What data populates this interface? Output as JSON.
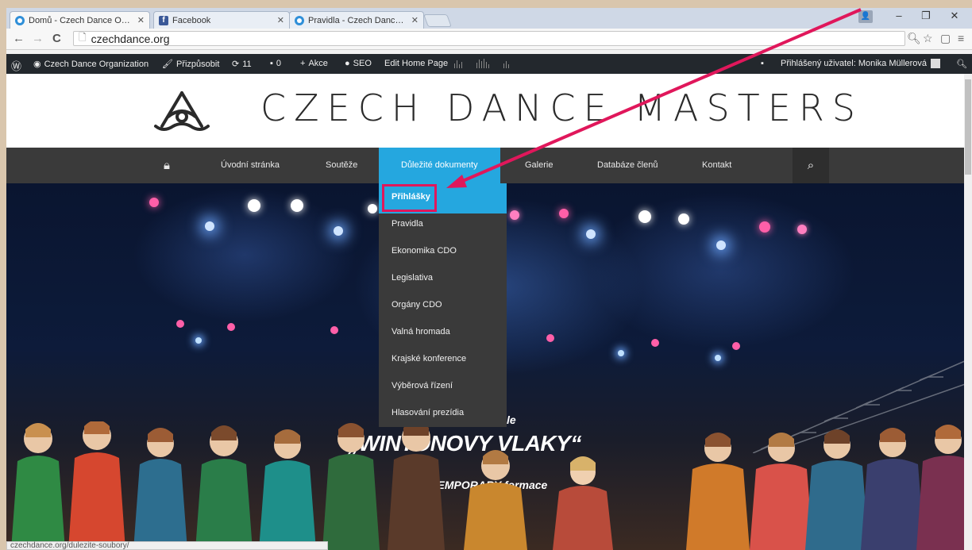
{
  "browser": {
    "tabs": [
      {
        "title": "Domů - Czech Dance Orga",
        "favicon": "chrome-globe-icon",
        "color": "#2f8fd8"
      },
      {
        "title": "Facebook",
        "favicon": "facebook-icon",
        "color": "#3b5998"
      },
      {
        "title": "Pravidla - Czech Dance Or",
        "favicon": "chrome-globe-icon",
        "color": "#2f8fd8"
      }
    ],
    "url": "czechdance.org",
    "status_url": "czechdance.org/dulezite-soubory/"
  },
  "admin_bar": {
    "site_name": "Czech Dance Organization",
    "customize": "Přizpůsobit",
    "updates": "11",
    "comments": "0",
    "new": "Akce",
    "seo": "SEO",
    "edit": "Edit Home Page",
    "user": "Přihlášený uživatel: Monika Müllerová"
  },
  "site": {
    "title": "CZECH DANCE MASTERS"
  },
  "nav": {
    "items": [
      {
        "label": "Úvodní stránka"
      },
      {
        "label": "Soutěže"
      },
      {
        "label": "Důležité dokumenty"
      },
      {
        "label": "Galerie"
      },
      {
        "label": "Databáze členů"
      },
      {
        "label": "Kontakt"
      }
    ]
  },
  "dropdown": {
    "items": [
      {
        "label": "Přihlášky"
      },
      {
        "label": "Pravidla"
      },
      {
        "label": "Ekonomika CDO"
      },
      {
        "label": "Legislativa"
      },
      {
        "label": "Orgány CDO"
      },
      {
        "label": "Valná hromada"
      },
      {
        "label": "Krajské konference"
      },
      {
        "label": "Výběrová řízení"
      },
      {
        "label": "Hlasování prezídia"
      }
    ]
  },
  "hero": {
    "partial_line": "le",
    "headline": "„WINTONOVY VLAKY“",
    "subline": "TEMPORARY formace"
  },
  "colors": {
    "accent": "#25a7df",
    "nav_bg": "#3a3a3a",
    "admin_bg": "#23282d",
    "annotation": "#e0175b"
  }
}
